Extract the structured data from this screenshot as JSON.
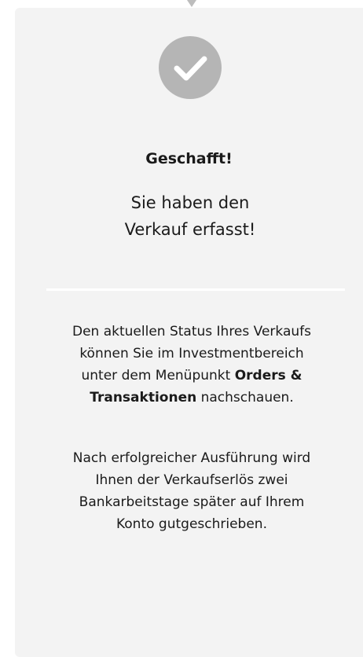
{
  "status": {
    "title": "Geschafft!",
    "subtitle": "Sie haben den Verkauf erfasst!",
    "icon": "checkmark-icon",
    "icon_color": "#b5b5b5"
  },
  "info": {
    "p1_prefix": "Den aktuellen Status Ihres Verkaufs können Sie im Investmentbereich unter dem Menüpunkt ",
    "p1_bold": "Orders & Transaktionen",
    "p1_suffix": " nachschauen.",
    "p2": "Nach erfolgreicher Ausführung wird Ihnen der Verkaufserlös zwei Bankarbeitstage später auf Ihrem Konto gutgeschrieben."
  }
}
